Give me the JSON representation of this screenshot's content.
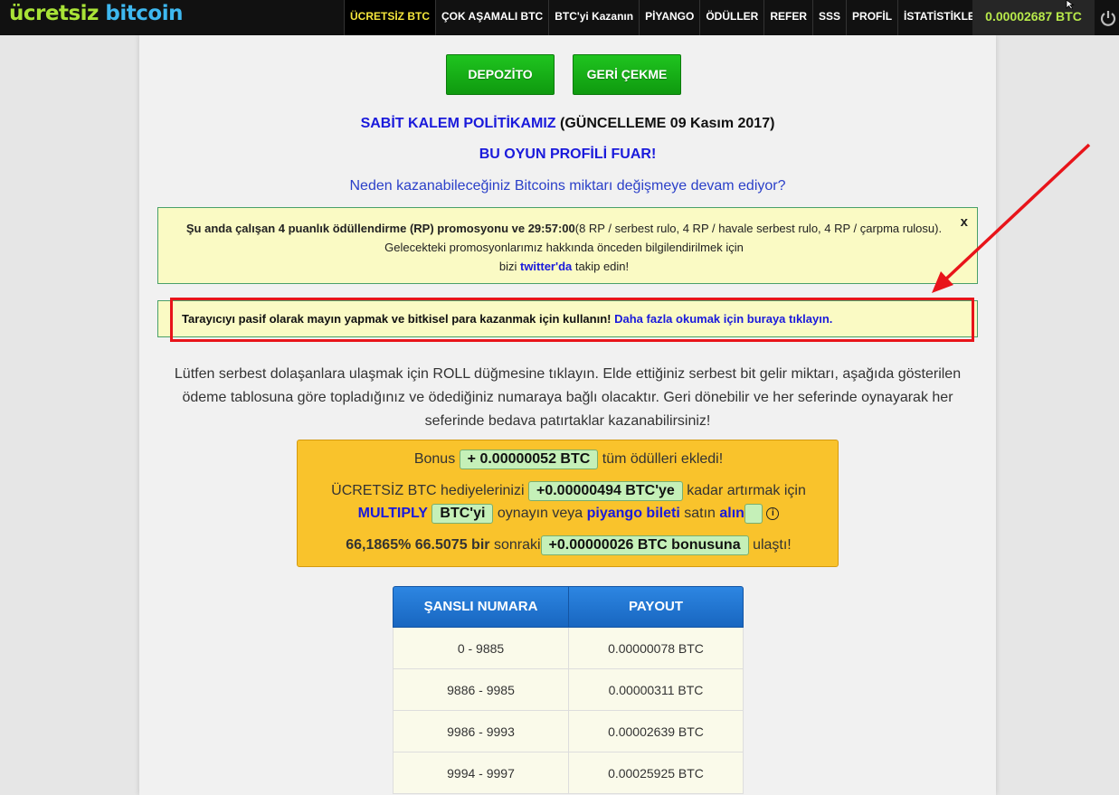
{
  "logo": {
    "part1": "ücretsiz",
    "part2": "bitcoin"
  },
  "nav": [
    {
      "label": "ÜCRETSİZ BTC",
      "active": true
    },
    {
      "label": "ÇOK AŞAMALI BTC"
    },
    {
      "label": "BTC'yi Kazanın"
    },
    {
      "label": "PİYANGO"
    },
    {
      "label": "ÖDÜLLER"
    },
    {
      "label": "REFER"
    },
    {
      "label": "SSS"
    },
    {
      "label": "PROFİL"
    },
    {
      "label": "İSTATİSTİKLER"
    }
  ],
  "balance": "0.00002687 BTC",
  "buttons": {
    "deposit": "DEPOZİTO",
    "withdraw": "GERİ ÇEKME"
  },
  "policy": {
    "link": "SABİT KALEM POLİTİKAMIZ",
    "update": "(GÜNCELLEME 09 Kasım 2017)"
  },
  "fair": "BU OYUN PROFİLİ FUAR!",
  "why_link": "Neden kazanabileceğiniz Bitcoins miktarı değişmeye devam ediyor?",
  "promo": {
    "bold": "Şu anda çalışan 4 puanlık ödüllendirme (RP) promosyonu ve 29:57:00",
    "rest": "(8 RP / serbest rulo, 4 RP / havale serbest rulo, 4 RP / çarpma rulosu). Gelecekteki promosyonlarımız hakkında önceden bilgilendirilmek için",
    "pre_link": "bizi",
    "link": "twitter'da",
    "post_link": "takip edin!",
    "close": "x"
  },
  "mine": {
    "text": "Tarayıcıyı pasif olarak mayın yapmak ve bitkisel para kazanmak için kullanın!",
    "link": "Daha fazla okumak için buraya tıklayın."
  },
  "description": "Lütfen serbest dolaşanlara ulaşmak için ROLL düğmesine tıklayın. Elde ettiğiniz serbest bit gelir miktarı, aşağıda gösterilen ödeme tablosuna göre topladığınız ve ödediğiniz numaraya bağlı olacaktır. Geri dönebilir ve her seferinde oynayarak her seferinde bedava patırtaklar kazanabilirsiniz!",
  "bonus": {
    "l1_pre": "Bonus",
    "l1_pill": "+ 0.00000052 BTC",
    "l1_post": "tüm ödülleri ekledi!",
    "l2_pre": "ÜCRETSİZ BTC hediyelerinizi",
    "l2_pill": "+0.00000494 BTC'ye",
    "l2_post": "kadar artırmak için",
    "l3_multiply": "MULTIPLY",
    "l3_pill": "BTC'yi",
    "l3_mid": "oynayın veya",
    "l3_lottery": "piyango bileti",
    "l3_buy": "satın",
    "l3_alin": "alın",
    "l4_bold": "66,1865% 66.5075 bir",
    "l4_mid": "sonraki",
    "l4_pill": "+0.00000026 BTC bonusuna",
    "l4_post": "ulaştı!"
  },
  "payout_table": {
    "headers": [
      "ŞANSLI NUMARA",
      "PAYOUT"
    ],
    "rows": [
      [
        "0 - 9885",
        "0.00000078 BTC"
      ],
      [
        "9886 - 9985",
        "0.00000311 BTC"
      ],
      [
        "9986 - 9993",
        "0.00002639 BTC"
      ],
      [
        "9994 - 9997",
        "0.00025925 BTC"
      ]
    ]
  },
  "colors": {
    "accent_green": "#1fc41f",
    "annotation_red": "#e8141a",
    "table_blue": "#2d86e2",
    "bonus_yellow": "#f9c32c"
  }
}
